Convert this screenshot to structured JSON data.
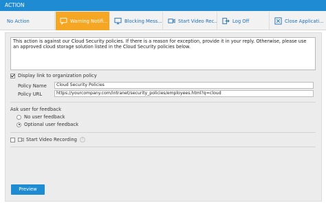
{
  "header": {
    "title": "ACTION"
  },
  "tabs": [
    {
      "label": "No Action",
      "icon": "none"
    },
    {
      "label": "Warning Notifi...",
      "icon": "speech-bubble-icon",
      "active": true
    },
    {
      "label": "Blocking Mess...",
      "icon": "monitor-icon"
    },
    {
      "label": "Start Video Rec...",
      "icon": "video-camera-icon"
    },
    {
      "label": "Log Off",
      "icon": "logout-icon"
    },
    {
      "label": "Close Applicati...",
      "icon": "close-window-icon"
    }
  ],
  "message": {
    "text": "This action is against our Cloud Security policies. If there is a reason for exception, provide it in your reply. Otherwise, please use an approved cloud storage solution listed in the Cloud Security policies below."
  },
  "policy": {
    "display_link_label": "Display link to organization policy",
    "display_link_checked": true,
    "name_label": "Policy Name",
    "name_value": "Cloud Security Policies",
    "url_label": "Policy URL",
    "url_value": "https://yourcompany.com/intranet/security_policies/employees.html?q=cloud"
  },
  "feedback": {
    "title": "Ask user for feedback",
    "options": [
      {
        "label": "No user feedback",
        "selected": false
      },
      {
        "label": "Optional user feedback",
        "selected": true
      }
    ]
  },
  "video": {
    "label": "Start Video Recording",
    "checked": false
  },
  "buttons": {
    "preview": "Preview"
  },
  "colors": {
    "accent": "#1f8bd3",
    "active_tab": "#f5a623",
    "link": "#1c6fb5"
  }
}
